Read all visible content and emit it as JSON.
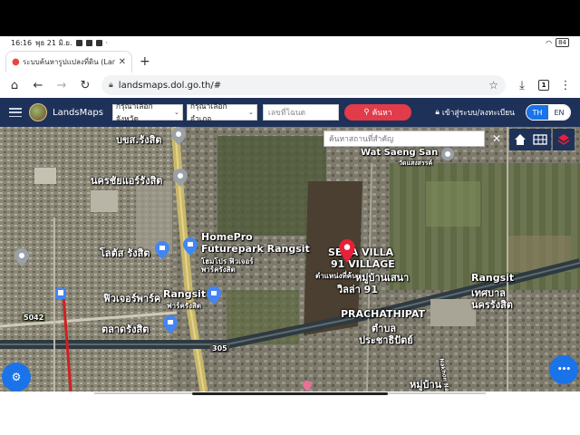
{
  "status_bar": {
    "time": "16:16",
    "date": "พุธ 21 มิ.ย.",
    "battery": "84"
  },
  "browser": {
    "tab_title": "ระบบค้นหารูปแปลงที่ดิน (LandsMaps)",
    "new_tab": "+",
    "url": "landsmaps.dol.go.th/#",
    "tab_count": "1"
  },
  "app_header": {
    "brand": "LandsMaps",
    "province_select": "กรุณาเลือกจังหวัด",
    "district_select": "กรุณาเลือกอำเภอ",
    "deed_placeholder": "เลขที่โฉนด",
    "search_label": "ค้นหา",
    "login_label": "เข้าสู่ระบบ/ลงทะเบียน",
    "lang_th": "TH",
    "lang_en": "EN"
  },
  "map": {
    "place_search_placeholder": "ค้นหาสถานที่สำคัญ",
    "labels": {
      "bkc_rangsit": "บขส.รังสิต",
      "nakhon_chai_air": "นครชัยแอร์รังสิต",
      "wat_saeng_san_en": "Wat Saeng San",
      "wat_saeng_san_th": "วัดแสงสรรค์",
      "homepro_1": "HomePro",
      "homepro_2": "Futurepark Rangsit",
      "homepro_th_1": "โฮมโปร ฟิวเจอร์",
      "homepro_th_2": "พาร์ครังสิต",
      "lotus": "โลตัส รังสิต",
      "sena_villa_1": "SENA VILLA",
      "sena_villa_2": "91 VILLAGE",
      "sena_villa_th_1": "ตำแหน่งที่ค้นหา",
      "sena_villa_th_2": "หมู่บ้านเสนา",
      "sena_villa_th_3": "วิลล่า 91",
      "future_park": "ฟิวเจอร์พาร์ค",
      "rangsit_mall_en": "Rangsit",
      "rangsit_mall_th": "ฟาร์ครังสิต",
      "talat_rangsit": "ตลาดรังสิต",
      "rangsit_en": "Rangsit",
      "rangsit_th_1": "เทศบาล",
      "rangsit_th_2": "นครรังสิต",
      "prachathipat_en": "PRACHATHIPAT",
      "prachathipat_th_1": "ตำบล",
      "prachathipat_th_2": "ประชาธิปัตย์",
      "moo_ban": "หมู่บ้าน",
      "road_305": "305",
      "road_5042": "5042",
      "road_side": "Nakhon Nayok 46 Rd"
    }
  },
  "fab_more": "•••",
  "colors": {
    "header_bg": "#1e3159",
    "search_btn": "#e23b4a",
    "accent": "#1a73e8",
    "pin": "#e8203a"
  }
}
